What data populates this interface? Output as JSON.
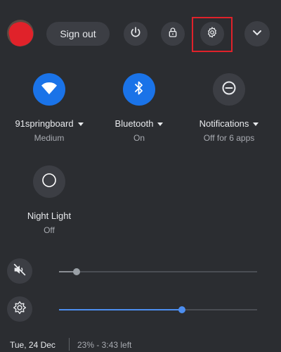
{
  "header": {
    "sign_out_label": "Sign out",
    "avatar_icon": "user-avatar",
    "highlight_color": "#e0222a"
  },
  "tiles": [
    {
      "label": "91springboard",
      "sub": "Medium",
      "icon": "wifi-icon",
      "on": true
    },
    {
      "label": "Bluetooth",
      "sub": "On",
      "icon": "bluetooth-icon",
      "on": true
    },
    {
      "label": "Notifications",
      "sub": "Off for 6 apps",
      "icon": "do-not-disturb-icon",
      "on": false
    },
    {
      "label": "Night Light",
      "sub": "Off",
      "icon": "night-light-icon",
      "on": false
    }
  ],
  "sliders": {
    "volume": {
      "icon": "volume-muted-icon",
      "value": 0.09
    },
    "brightness": {
      "icon": "brightness-icon",
      "value": 0.62
    }
  },
  "footer": {
    "date": "Tue, 24 Dec",
    "battery": "23% - 3:43 left"
  },
  "colors": {
    "accent": "#1a73e8",
    "accent_light": "#4d8ef0",
    "panel_bg": "#2b2d31"
  }
}
